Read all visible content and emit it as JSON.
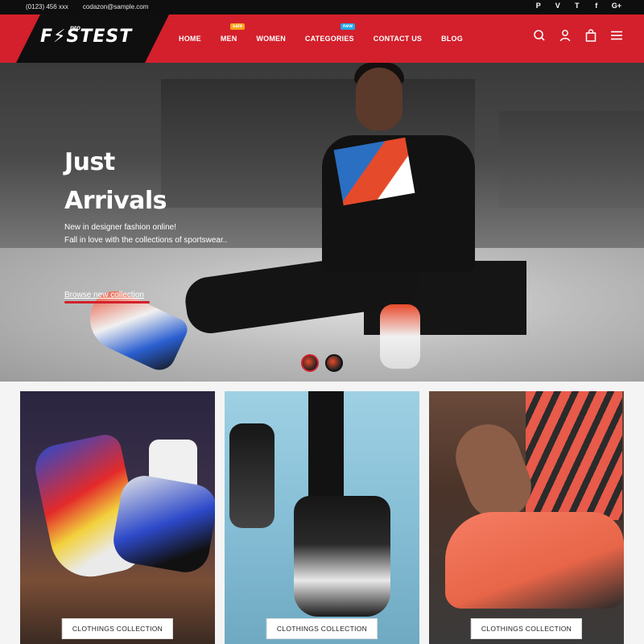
{
  "topbar": {
    "phone": "(0123) 456 xxx",
    "email": "codazon@sample.com",
    "social": [
      "P",
      "V",
      "T",
      "f",
      "G+"
    ]
  },
  "header": {
    "logo_text": "F⚡STEST",
    "logo_sub": "pro",
    "nav": [
      {
        "label": "HOME",
        "badge": ""
      },
      {
        "label": "MEN",
        "badge": "sale"
      },
      {
        "label": "WOMEN",
        "badge": ""
      },
      {
        "label": "CATEGORIES",
        "badge": "new"
      },
      {
        "label": "CONTACT US",
        "badge": ""
      },
      {
        "label": "BLOG",
        "badge": ""
      }
    ],
    "icons": [
      "search-icon",
      "user-icon",
      "bag-icon",
      "menu-icon"
    ],
    "brand_color": "#d3202c"
  },
  "hero": {
    "title_line1": "Just",
    "title_line2": "Arrivals",
    "subtitle_line1": "New in designer fashion online!",
    "subtitle_line2": "Fall in love with the collections of sportswear..",
    "link": "Browse new collection"
  },
  "collections": [
    {
      "button": "CLOTHINGS COLLECTION"
    },
    {
      "button": "CLOTHINGS COLLECTION"
    },
    {
      "button": "CLOTHINGS COLLECTION"
    }
  ]
}
